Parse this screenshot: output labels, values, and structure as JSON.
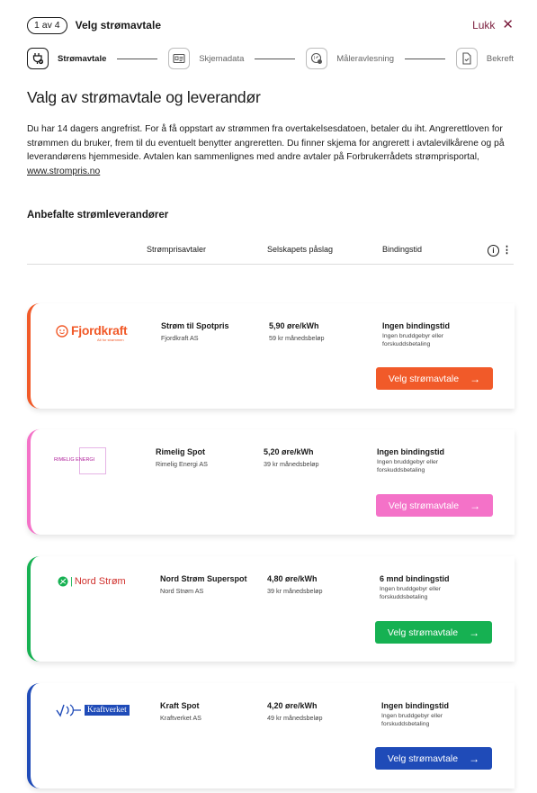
{
  "header": {
    "step_indicator": "1 av 4",
    "title": "Velg strømavtale",
    "close_label": "Lukk",
    "close_icon": "✕"
  },
  "stepper": [
    {
      "label": "Strømavtale",
      "icon": "plug-icon",
      "active": true
    },
    {
      "label": "Skjemadata",
      "icon": "id-card-icon",
      "active": false
    },
    {
      "label": "Måleravlesning",
      "icon": "meter-icon",
      "active": false
    },
    {
      "label": "Bekreft",
      "icon": "document-check-icon",
      "active": false
    }
  ],
  "main": {
    "title": "Valg av strømavtale og leverandør",
    "intro": "Du har 14 dagers angrefrist. For å få oppstart av strømmen fra overtakelsesdatoen, betaler du iht. Angrerettloven for strømmen du bruker, frem til du eventuelt benytter angreretten. Du finner skjema for angrerett i avtalevilkårene og på leverandørens hjemmeside. Avtalen kan sammenlignes med andre avtaler på Forbrukerrådets strømprisportal, ",
    "intro_link": "www.strompris.no",
    "section_title": "Anbefalte strømleverandører"
  },
  "table_header": {
    "col_agreement": "Strømprisavtaler",
    "col_markup": "Selskapets påslag",
    "col_binding": "Bindingstid",
    "info_icon": "i",
    "more_icon": "⋮"
  },
  "providers": [
    {
      "logo_text": "Fjordkraft",
      "logo_sub": "Alt for strømmen",
      "product": "Strøm til Spotpris",
      "company": "Fjordkraft AS",
      "price": "5,90 øre/kWh",
      "monthly": "59 kr månedsbeløp",
      "binding": "Ingen bindingstid",
      "binding_note": "Ingen bruddgebyr eller forskuddsbetaling",
      "cta": "Velg strømavtale",
      "color": "#f15a29"
    },
    {
      "logo_text": "RIMELIG ENERGI",
      "product": "Rimelig Spot",
      "company": "Rimelig Energi AS",
      "price": "5,20 øre/kWh",
      "monthly": "39 kr månedsbeløp",
      "binding": "Ingen bindingstid",
      "binding_note": "Ingen bruddgebyr eller forskuddsbetaling",
      "cta": "Velg strømavtale",
      "color": "#f472c8"
    },
    {
      "logo_text": "Nord Strøm",
      "product": "Nord Strøm Superspot",
      "company": "Nord Strøm AS",
      "price": "4,80 øre/kWh",
      "monthly": "39 kr månedsbeløp",
      "binding": "6 mnd bindingstid",
      "binding_note": "Ingen bruddgebyr eller forskuddsbetaling",
      "cta": "Velg strømavtale",
      "color": "#16b152"
    },
    {
      "logo_text": "Kraftverket",
      "product": "Kraft Spot",
      "company": "Kraftverket AS",
      "price": "4,20 øre/kWh",
      "monthly": "49 kr månedsbeløp",
      "binding": "Ingen bindingstid",
      "binding_note": "Ingen bruddgebyr eller forskuddsbetaling",
      "cta": "Velg strømavtale",
      "color": "#1f4bb8"
    }
  ],
  "colors": {
    "accent_close": "#7a1c3c"
  }
}
